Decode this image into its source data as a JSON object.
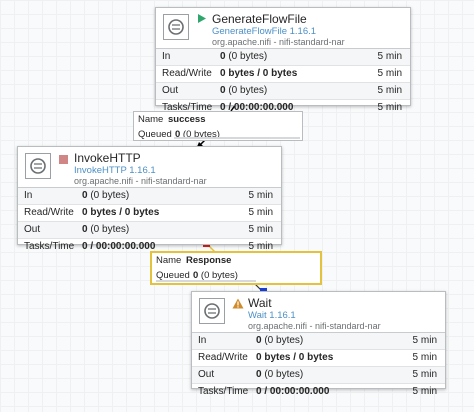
{
  "processors": [
    {
      "name": "GenerateFlowFile",
      "type": "GenerateFlowFile 1.16.1",
      "bundle": "org.apache.nifi - nifi-standard-nar",
      "status": "running",
      "status_icon": "play-icon",
      "stats": [
        {
          "label": "In",
          "value_bold": "0",
          "value_rest": " (0 bytes)",
          "time": "5 min"
        },
        {
          "label": "Read/Write",
          "value_bold": "0 bytes / 0 bytes",
          "value_rest": "",
          "time": "5 min"
        },
        {
          "label": "Out",
          "value_bold": "0",
          "value_rest": " (0 bytes)",
          "time": "5 min"
        },
        {
          "label": "Tasks/Time",
          "value_bold": "0 / 00:00:00.000",
          "value_rest": "",
          "time": "5 min"
        }
      ]
    },
    {
      "name": "InvokeHTTP",
      "type": "InvokeHTTP 1.16.1",
      "bundle": "org.apache.nifi - nifi-standard-nar",
      "status": "stopped",
      "status_icon": "stop-icon",
      "stats": [
        {
          "label": "In",
          "value_bold": "0",
          "value_rest": " (0 bytes)",
          "time": "5 min"
        },
        {
          "label": "Read/Write",
          "value_bold": "0 bytes / 0 bytes",
          "value_rest": "",
          "time": "5 min"
        },
        {
          "label": "Out",
          "value_bold": "0",
          "value_rest": " (0 bytes)",
          "time": "5 min"
        },
        {
          "label": "Tasks/Time",
          "value_bold": "0 / 00:00:00.000",
          "value_rest": "",
          "time": "5 min"
        }
      ]
    },
    {
      "name": "Wait",
      "type": "Wait 1.16.1",
      "bundle": "org.apache.nifi - nifi-standard-nar",
      "status": "invalid",
      "status_icon": "warning-icon",
      "stats": [
        {
          "label": "In",
          "value_bold": "0",
          "value_rest": " (0 bytes)",
          "time": "5 min"
        },
        {
          "label": "Read/Write",
          "value_bold": "0 bytes / 0 bytes",
          "value_rest": "",
          "time": "5 min"
        },
        {
          "label": "Out",
          "value_bold": "0",
          "value_rest": " (0 bytes)",
          "time": "5 min"
        },
        {
          "label": "Tasks/Time",
          "value_bold": "0 / 00:00:00.000",
          "value_rest": "",
          "time": "5 min"
        }
      ]
    }
  ],
  "connections": [
    {
      "name_label": "Name",
      "name_value": "success",
      "queued_label": "Queued",
      "queued_bold": "0",
      "queued_rest": " (0 bytes)"
    },
    {
      "name_label": "Name",
      "name_value": "Response",
      "queued_label": "Queued",
      "queued_bold": "0",
      "queued_rest": " (0 bytes)"
    }
  ],
  "colors": {
    "running": "#2fa66b",
    "stopped": "#d18686",
    "warning": "#d08b2a",
    "selected_border": "#e3c23d",
    "link": "#4d90c7"
  }
}
